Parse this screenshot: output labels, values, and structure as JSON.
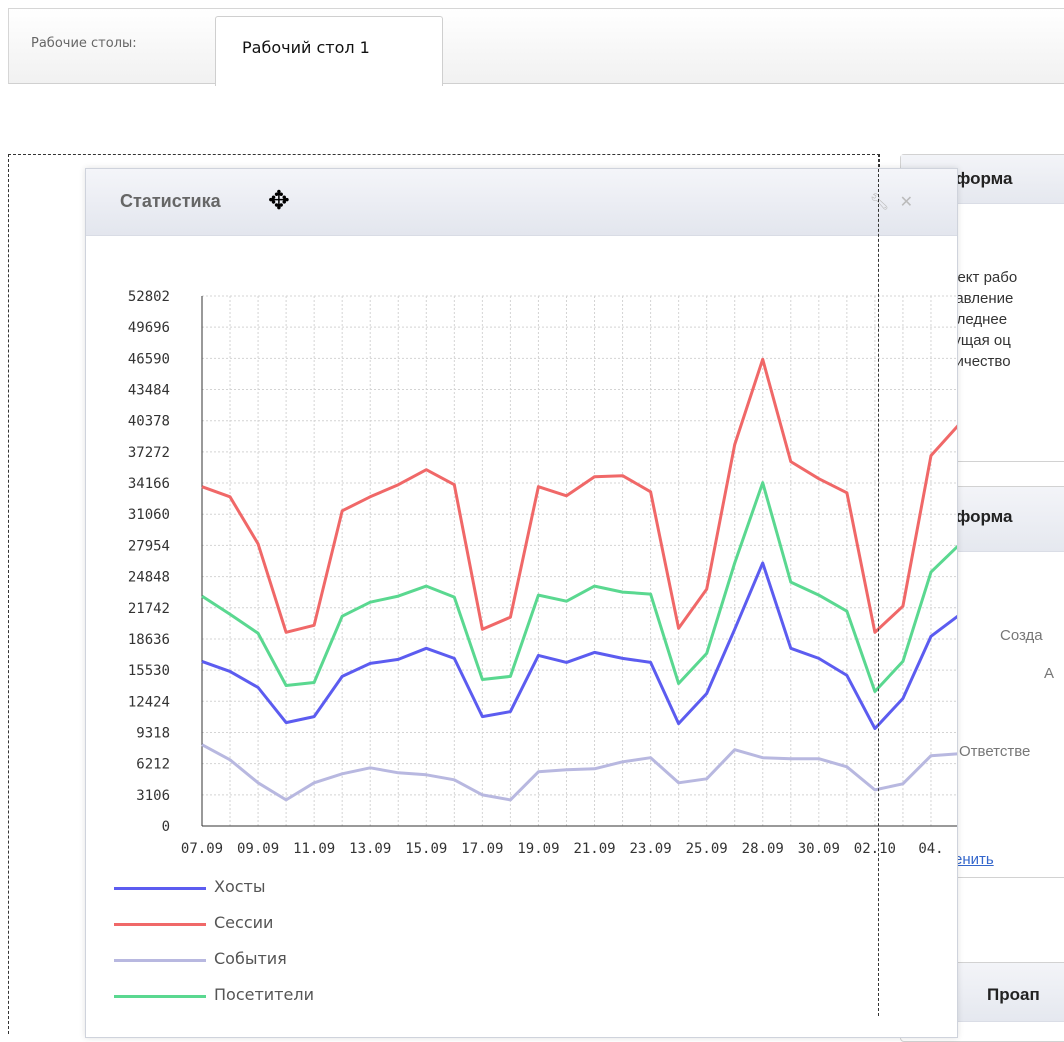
{
  "tabs": {
    "label": "Рабочие столы:",
    "active": "Рабочий стол 1"
  },
  "stats_widget": {
    "title": "Статистика",
    "icons": [
      "wrench-icon",
      "close-icon"
    ]
  },
  "right_widgets": {
    "info1": {
      "title": "Информа",
      "lines": [
        "Проект рабо",
        "Управление",
        "Последнее",
        "Текущая оц",
        "Количество"
      ]
    },
    "info2": {
      "title": "Информа",
      "created": "Созда",
      "a": "А",
      "responsible": "Ответстве",
      "edit_link": "Изменить"
    },
    "project": {
      "title": "Проап",
      "icon": "lock-icon"
    }
  },
  "chart_data": {
    "type": "line",
    "title": "",
    "xlabel": "",
    "ylabel": "",
    "yticks": [
      0,
      3106,
      6212,
      9318,
      12424,
      15530,
      18636,
      21742,
      24848,
      27954,
      31060,
      34166,
      37272,
      40378,
      43484,
      46590,
      49696,
      52802
    ],
    "xtick_labels": [
      "07.09",
      "09.09",
      "11.09",
      "13.09",
      "15.09",
      "17.09",
      "19.09",
      "21.09",
      "23.09",
      "25.09",
      "28.09",
      "30.09",
      "02.10",
      "04."
    ],
    "ylim": [
      0,
      52802
    ],
    "grid": true,
    "legend": "bottom-left",
    "series": [
      {
        "name": "Хосты",
        "color": "#5c5cf0",
        "values": [
          16400,
          15400,
          13800,
          10300,
          10900,
          14900,
          16200,
          16600,
          17700,
          16700,
          10900,
          11400,
          17000,
          16300,
          17300,
          16700,
          16300,
          10200,
          13200,
          19600,
          26200,
          17700,
          16700,
          15000,
          9700,
          12700,
          18900,
          21000
        ]
      },
      {
        "name": "Сессии",
        "color": "#f06868",
        "values": [
          33800,
          32800,
          28100,
          19300,
          20000,
          31400,
          32800,
          34000,
          35500,
          34000,
          19600,
          20800,
          33800,
          32900,
          34800,
          34900,
          33300,
          19700,
          23600,
          38000,
          46500,
          36300,
          34600,
          33200,
          19300,
          21900,
          36900,
          40000
        ]
      },
      {
        "name": "События",
        "color": "#b8b8e0",
        "values": [
          8100,
          6600,
          4300,
          2600,
          4300,
          5200,
          5800,
          5300,
          5100,
          4600,
          3100,
          2600,
          5400,
          5600,
          5700,
          6400,
          6800,
          4300,
          4700,
          7600,
          6800,
          6700,
          6700,
          5900,
          3600,
          4200,
          7000,
          7200
        ]
      },
      {
        "name": "Посетители",
        "color": "#5ad890",
        "values": [
          22900,
          21100,
          19200,
          14000,
          14300,
          20900,
          22300,
          22900,
          23900,
          22800,
          14600,
          14900,
          23000,
          22400,
          23900,
          23300,
          23100,
          14200,
          17200,
          26200,
          34200,
          24300,
          23000,
          21400,
          13400,
          16400,
          25300,
          28000
        ]
      }
    ]
  }
}
